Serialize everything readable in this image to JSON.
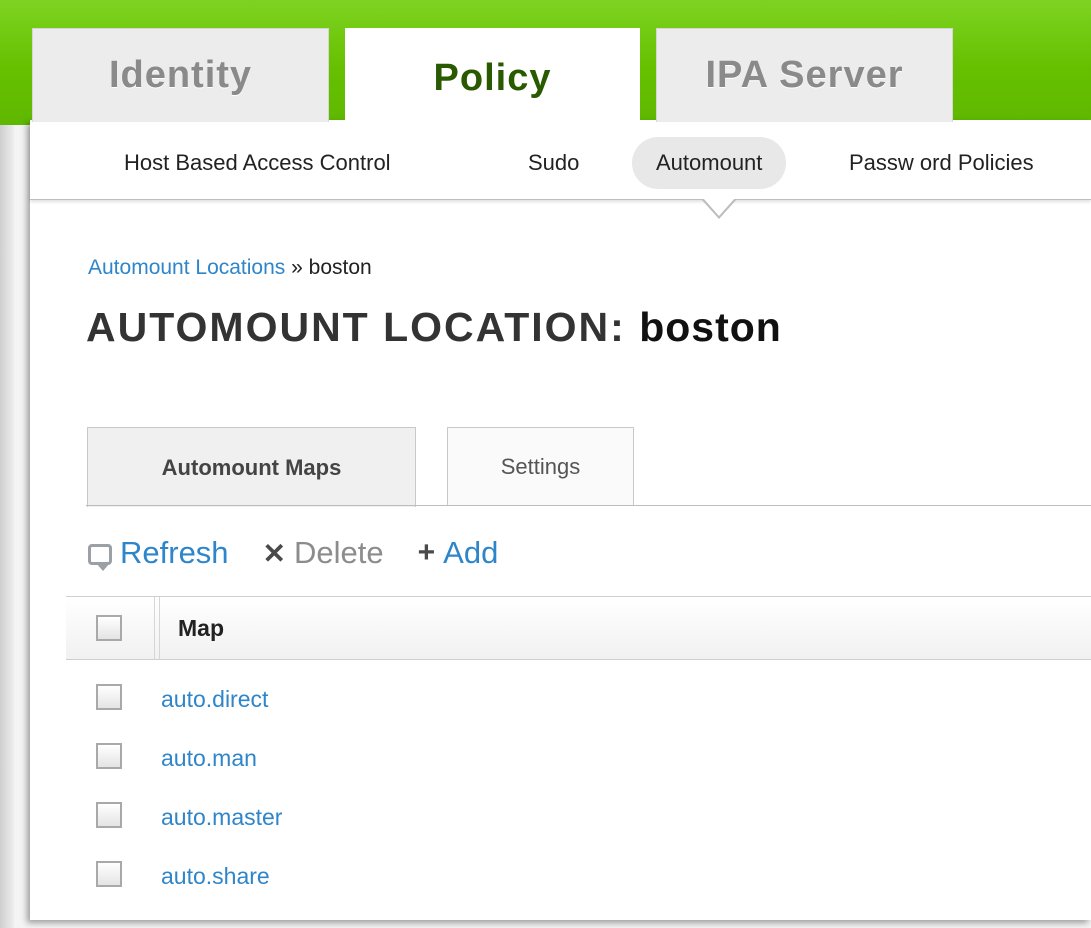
{
  "main_tabs": [
    {
      "label": "Identity",
      "active": false
    },
    {
      "label": "Policy",
      "active": true
    },
    {
      "label": "IPA Server",
      "active": false
    }
  ],
  "sub_nav": [
    {
      "label": "Host Based Access Control",
      "selected": false
    },
    {
      "label": "Sudo",
      "selected": false
    },
    {
      "label": "Automount",
      "selected": true
    },
    {
      "label": "Passw ord Policies",
      "selected": false
    }
  ],
  "breadcrumb": {
    "parent": "Automount Locations",
    "separator": "»",
    "current": "boston"
  },
  "page_title": {
    "prefix": "AUTOMOUNT LOCATION:",
    "name": "boston"
  },
  "facet_tabs": [
    {
      "label": "Automount Maps",
      "selected": true
    },
    {
      "label": "Settings",
      "selected": false
    }
  ],
  "actions": {
    "refresh": "Refresh",
    "delete": "Delete",
    "add": "Add"
  },
  "table": {
    "column": "Map",
    "rows": [
      "auto.direct",
      "auto.man",
      "auto.master",
      "auto.share"
    ]
  },
  "colors": {
    "header_green": "#66c000",
    "link_blue": "#2f85c9",
    "active_tab_text": "#2a5a00"
  }
}
